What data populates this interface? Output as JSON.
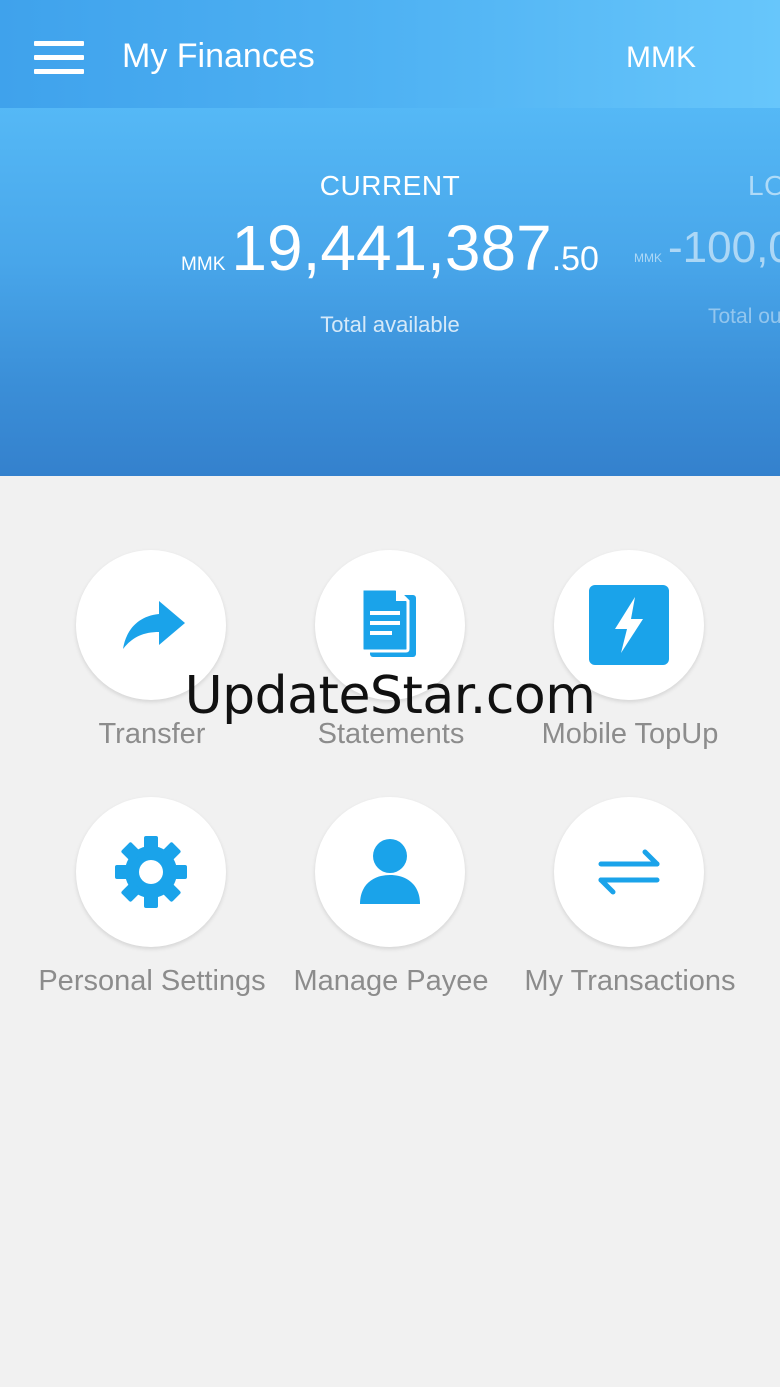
{
  "header": {
    "title": "My Finances",
    "currency": "MMK",
    "menu_icon": "hamburger-menu-icon"
  },
  "accounts": [
    {
      "label": "CURRENT",
      "currency": "MMK",
      "amount_main": "19,441,387",
      "amount_decimal": ".50",
      "subtitle": "Total available"
    },
    {
      "label": "LO",
      "currency": "MMK",
      "amount_main": "-100,0",
      "subtitle": "Total ou"
    }
  ],
  "actions": [
    {
      "label": "Transfer",
      "icon": "share-arrow-icon"
    },
    {
      "label": "Statements",
      "icon": "document-icon"
    },
    {
      "label": "Mobile TopUp",
      "icon": "lightning-icon"
    },
    {
      "label": "Personal Settings",
      "icon": "gear-icon"
    },
    {
      "label": "Manage Payee",
      "icon": "person-icon"
    },
    {
      "label": "My Transactions",
      "icon": "swap-arrows-icon"
    }
  ],
  "watermark": "UpdateStar.com",
  "colors": {
    "accent": "#1aa3ea",
    "header_top": "#5ec3fb",
    "header_bottom": "#3481cd",
    "background": "#f1f1f1",
    "label_gray": "#8c8c8c"
  }
}
